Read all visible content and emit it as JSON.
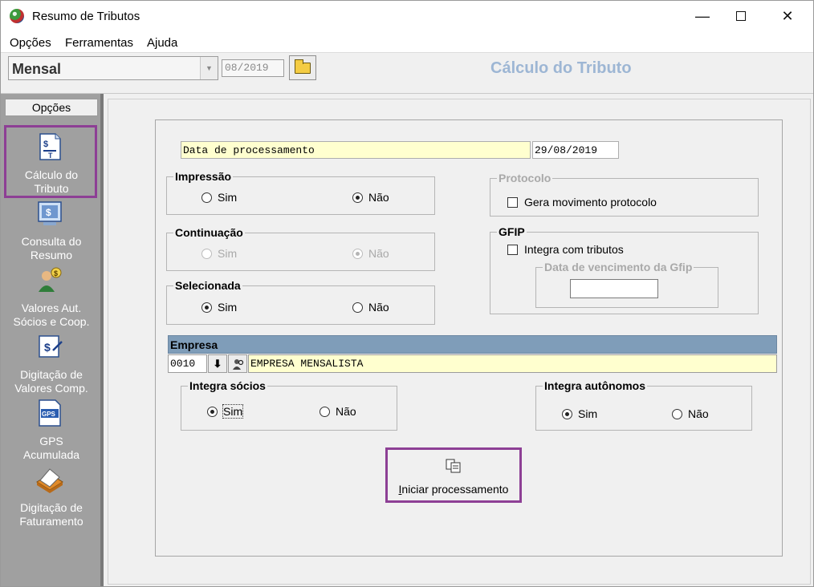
{
  "window": {
    "title": "Resumo de Tributos"
  },
  "menu": [
    "Opções",
    "Ferramentas",
    "Ajuda"
  ],
  "toolbar": {
    "period": "Mensal",
    "month": "08/2019",
    "title": "Cálculo do Tributo"
  },
  "sidebar": {
    "header": "Opções",
    "items": [
      {
        "label": "Cálculo do\nTributo",
        "icon": "calculo-tributo-icon"
      },
      {
        "label": "Consulta do\nResumo",
        "icon": "consulta-resumo-icon"
      },
      {
        "label": "Valores Aut.\nSócios e  Coop.",
        "icon": "valores-autonomos-icon"
      },
      {
        "label": "Digitação de\nValores Comp.",
        "icon": "digitacao-valores-icon"
      },
      {
        "label": "GPS\nAcumulada",
        "icon": "gps-icon"
      },
      {
        "label": "Digitação de\nFaturamento",
        "icon": "faturamento-icon"
      }
    ]
  },
  "form": {
    "data_label": "Data de processamento",
    "data_value": "29/08/2019",
    "impressao": {
      "legend": "Impressão",
      "sim": "Sim",
      "nao": "Não",
      "selected": "nao"
    },
    "continuacao": {
      "legend": "Continuação",
      "sim": "Sim",
      "nao": "Não",
      "selected": "nao",
      "disabled": true
    },
    "selecionada": {
      "legend": "Selecionada",
      "sim": "Sim",
      "nao": "Não",
      "selected": "sim"
    },
    "protocolo": {
      "legend": "Protocolo",
      "checkbox": "Gera movimento protocolo"
    },
    "gfip": {
      "legend": "GFIP",
      "checkbox": "Integra com tributos",
      "subgroup": "Data de vencimento da Gfip",
      "date_value": ""
    },
    "empresa": {
      "header": "Empresa",
      "code": "0010",
      "name": "EMPRESA MENSALISTA"
    },
    "integra_socios": {
      "legend": "Integra sócios",
      "sim": "Sim",
      "nao": "Não",
      "selected": "sim"
    },
    "integra_autonomos": {
      "legend": "Integra autônomos",
      "sim": "Sim",
      "nao": "Não",
      "selected": "sim"
    },
    "process_button": {
      "mnemonic": "I",
      "rest": "niciar processamento"
    }
  },
  "colors": {
    "highlight": "#8d3f95",
    "toolbar_title": "#9db6d4",
    "empresa_header": "#7f9db9",
    "field_yellow": "#ffffcf",
    "sidebar_bg": "#a0a0a0"
  }
}
